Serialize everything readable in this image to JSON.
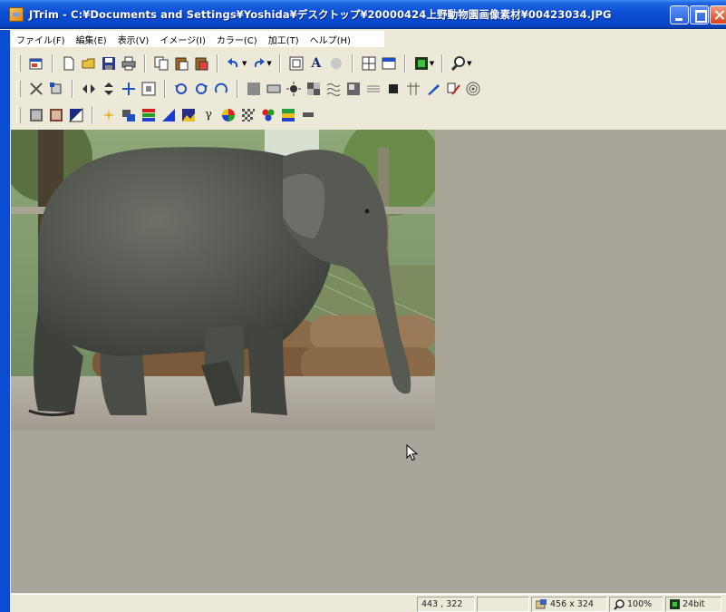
{
  "window": {
    "title": "JTrim - C:¥Documents and Settings¥Yoshida¥デスクトップ¥20000424上野動物園画像素材¥00423034.JPG"
  },
  "menu": [
    {
      "label": "ファイル(F)"
    },
    {
      "label": "編集(E)"
    },
    {
      "label": "表示(V)"
    },
    {
      "label": "イメージ(I)"
    },
    {
      "label": "カラー(C)"
    },
    {
      "label": "加工(T)"
    },
    {
      "label": "ヘルプ(H)"
    }
  ],
  "toolbar2": {
    "text_tool_label": "A"
  },
  "status": {
    "coords": "443 , 322",
    "dimensions": "456 x 324",
    "zoom": "100%",
    "bits": "24bit"
  },
  "colors": {
    "title_bar": "#0a4cd2",
    "canvas_background": "#a9a598",
    "chrome": "#ece9d8"
  }
}
